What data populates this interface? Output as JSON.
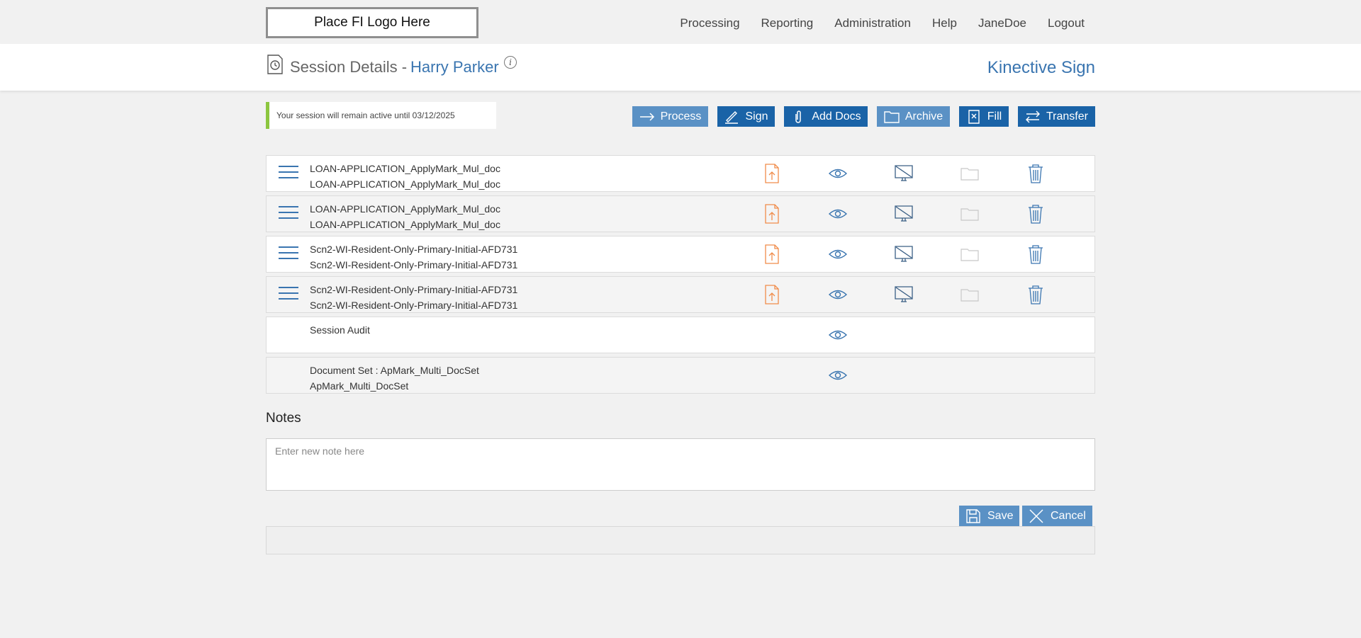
{
  "logo_text": "Place FI Logo Here",
  "nav": [
    "Processing",
    "Reporting",
    "Administration",
    "Help",
    "JaneDoe",
    "Logout"
  ],
  "header": {
    "title": "Session Details -",
    "customer_name": "Harry Parker",
    "info_glyph": "i",
    "brand": "Kinective Sign"
  },
  "notice": "Your session will remain active until 03/12/2025",
  "actions": {
    "process": "Process",
    "sign": "Sign",
    "add_docs": "Add Docs",
    "archive": "Archive",
    "fill": "Fill",
    "transfer": "Transfer"
  },
  "documents": [
    {
      "line1": "LOAN-APPLICATION_ApplyMark_Mul_doc",
      "line2": "LOAN-APPLICATION_ApplyMark_Mul_doc"
    },
    {
      "line1": "LOAN-APPLICATION_ApplyMark_Mul_doc",
      "line2": "LOAN-APPLICATION_ApplyMark_Mul_doc"
    },
    {
      "line1": "Scn2-WI-Resident-Only-Primary-Initial-AFD731",
      "line2": "Scn2-WI-Resident-Only-Primary-Initial-AFD731"
    },
    {
      "line1": "Scn2-WI-Resident-Only-Primary-Initial-AFD731",
      "line2": "Scn2-WI-Resident-Only-Primary-Initial-AFD731"
    },
    {
      "line1": "Session Audit",
      "line2": ""
    },
    {
      "line1": "Document Set : ApMark_Multi_DocSet",
      "line2": "ApMark_Multi_DocSet"
    }
  ],
  "notes": {
    "label": "Notes",
    "placeholder": "Enter new note here",
    "save": "Save",
    "cancel": "Cancel"
  },
  "colors": {
    "accent": "#3a75b0",
    "button_light": "#5a91c5",
    "button_dark": "#1a63a7",
    "upload_orange": "#f08c4a",
    "notice_green": "#8cc63f"
  },
  "icons": [
    "history-icon",
    "info-icon",
    "arrow-right-icon",
    "pen-icon",
    "paperclip-icon",
    "folder-icon",
    "fill-icon",
    "transfer-icon",
    "drag-handle-icon",
    "upload-file-icon",
    "eye-icon",
    "no-display-icon",
    "trash-icon",
    "save-icon",
    "close-icon"
  ]
}
